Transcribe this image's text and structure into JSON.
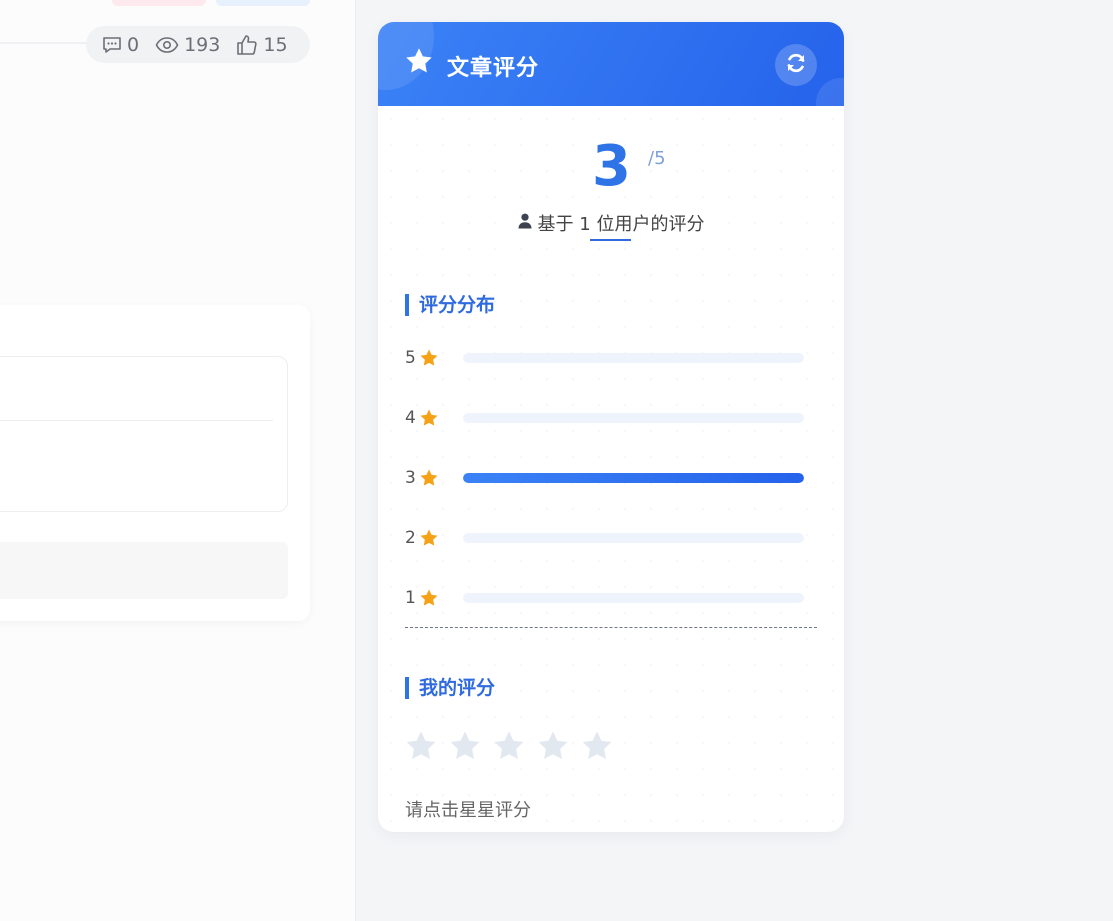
{
  "stats": {
    "comments": "0",
    "views": "193",
    "likes": "15"
  },
  "rating_card": {
    "title": "文章评分",
    "score": "3",
    "score_max": "/5",
    "based_on": "基于 1 位用户的评分",
    "distribution_title": "评分分布",
    "distribution": [
      {
        "stars": "5",
        "fraction": 0
      },
      {
        "stars": "4",
        "fraction": 0
      },
      {
        "stars": "3",
        "fraction": 1
      },
      {
        "stars": "2",
        "fraction": 0
      },
      {
        "stars": "1",
        "fraction": 0
      }
    ],
    "my_rating_title": "我的评分",
    "my_rating_value": 0,
    "my_rating_max": 5,
    "hint": "请点击星星评分"
  },
  "colors": {
    "accent": "#2f74e6",
    "header_gradient_start": "#3b82f6",
    "header_gradient_end": "#2563eb",
    "star_gold": "#f5a216",
    "star_empty": "#e2e8f0"
  },
  "icons": {
    "comments": "comment-icon",
    "views": "eye-icon",
    "likes": "thumbs-up-icon",
    "header": "star-icon",
    "refresh": "refresh-icon",
    "user": "user-icon"
  }
}
